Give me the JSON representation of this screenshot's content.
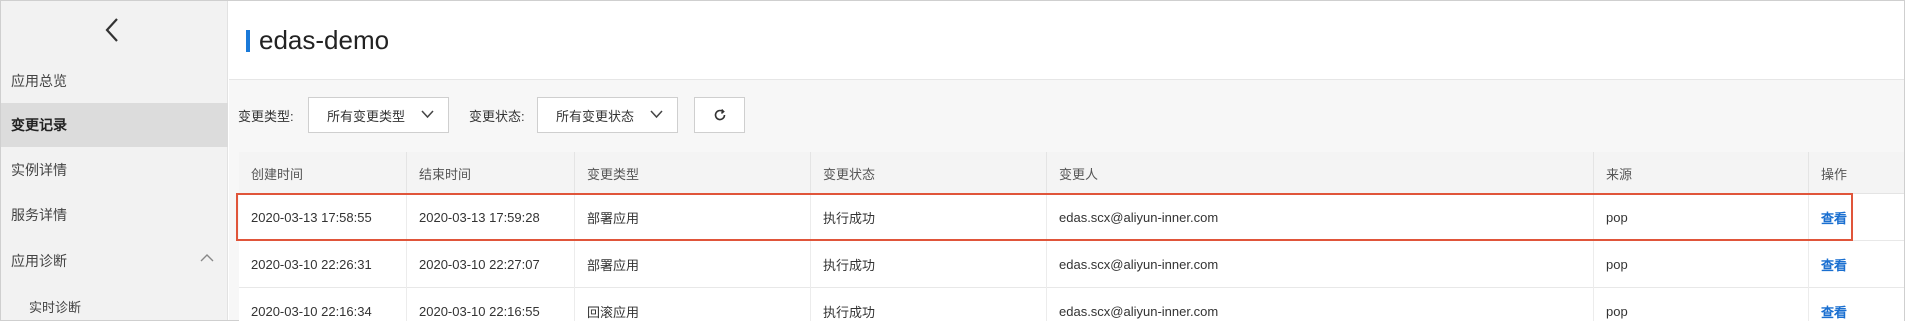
{
  "sidebar": {
    "back_icon": "chevron-left-icon",
    "items": [
      {
        "label": "应用总览"
      },
      {
        "label": "变更记录"
      },
      {
        "label": "实例详情"
      },
      {
        "label": "服务详情"
      },
      {
        "label": "应用诊断"
      },
      {
        "label": "实时诊断"
      }
    ],
    "active_index": 1
  },
  "header": {
    "title": "edas-demo",
    "accent_color": "#1a7ad9"
  },
  "filters": {
    "change_type_label": "变更类型:",
    "change_type_value": "所有变更类型",
    "change_status_label": "变更状态:",
    "change_status_value": "所有变更状态",
    "refresh_icon": "refresh-icon"
  },
  "table": {
    "columns": [
      "创建时间",
      "结束时间",
      "变更类型",
      "变更状态",
      "变更人",
      "来源",
      "操作"
    ],
    "rows": [
      {
        "created": "2020-03-13 17:58:55",
        "ended": "2020-03-13 17:59:28",
        "type": "部署应用",
        "status": "执行成功",
        "user": "edas.scx@aliyun-inner.com",
        "source": "pop",
        "action": "查看"
      },
      {
        "created": "2020-03-10 22:26:31",
        "ended": "2020-03-10 22:27:07",
        "type": "部署应用",
        "status": "执行成功",
        "user": "edas.scx@aliyun-inner.com",
        "source": "pop",
        "action": "查看"
      },
      {
        "created": "2020-03-10 22:16:34",
        "ended": "2020-03-10 22:16:55",
        "type": "回滚应用",
        "status": "执行成功",
        "user": "edas.scx@aliyun-inner.com",
        "source": "pop",
        "action": "查看"
      }
    ],
    "highlight_color": "#e0553a"
  }
}
